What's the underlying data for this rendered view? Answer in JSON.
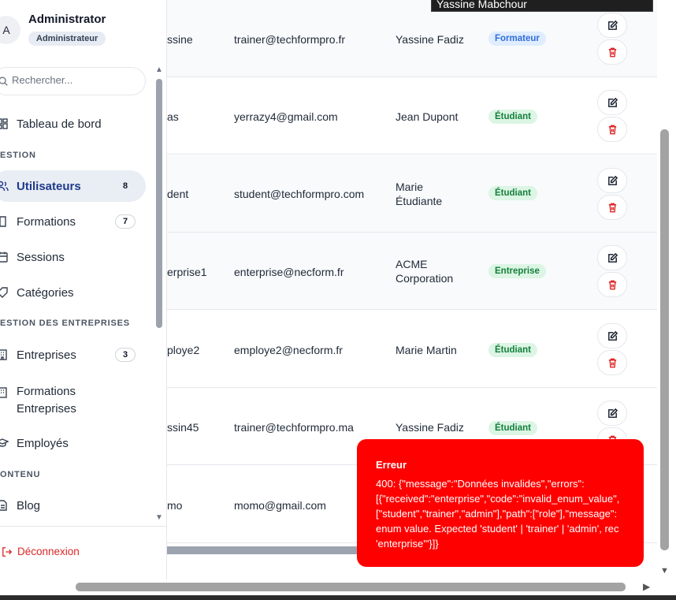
{
  "tooltip": {
    "text": "Yassine Mabchour"
  },
  "sidebar": {
    "avatar_letter": "A",
    "user_name": "Administrator",
    "user_role": "Administrateur",
    "search_placeholder": "Rechercher...",
    "sections": {
      "gestion": "ESTION",
      "entreprises": "ESTION DES ENTREPRISES",
      "contenu": "ONTENU"
    },
    "items": [
      {
        "label": "Tableau de bord",
        "icon": "dashboard-icon"
      },
      {
        "label": "Utilisateurs",
        "count": "8",
        "icon": "users-icon"
      },
      {
        "label": "Formations",
        "count": "7",
        "icon": "book-icon"
      },
      {
        "label": "Sessions",
        "icon": "calendar-icon"
      },
      {
        "label": "Catégories",
        "icon": "tag-icon"
      },
      {
        "label": "Entreprises",
        "count": "3",
        "icon": "building-icon"
      },
      {
        "label": "Formations Entreprises",
        "icon": "building-icon"
      },
      {
        "label": "Employés",
        "icon": "graduation-icon"
      },
      {
        "label": "Blog",
        "icon": "document-icon"
      }
    ],
    "logout_label": "Déconnexion"
  },
  "table": {
    "rows": [
      {
        "username": "ssine",
        "email": "trainer@techformpro.fr",
        "name": "Yassine Fadiz",
        "role": "Formateur"
      },
      {
        "username": "as",
        "email": "yerrazy4@gmail.com",
        "name": "Jean Dupont",
        "role": "Étudiant"
      },
      {
        "username": "dent",
        "email": "student@techformpro.com",
        "name": "Marie Étudiante",
        "role": "Étudiant"
      },
      {
        "username": "erprise1",
        "email": "enterprise@necform.fr",
        "name": "ACME Corporation",
        "role": "Entreprise"
      },
      {
        "username": "ploye2",
        "email": "employe2@necform.fr",
        "name": "Marie Martin",
        "role": "Étudiant"
      },
      {
        "username": "ssin45",
        "email": "trainer@techformpro.ma",
        "name": "Yassine Fadiz",
        "role": "Étudiant"
      },
      {
        "username": "mo",
        "email": "momo@gmail.com",
        "name": "",
        "role": ""
      }
    ]
  },
  "toast": {
    "title": "Erreur",
    "message": "400: {\"message\":\"Données invalides\",\"errors\":\n[{\"received\":\"enterprise\",\"code\":\"invalid_enum_value\",\n[\"student\",\"trainer\",\"admin\"],\"path\":[\"role\"],\"message\":\nenum value. Expected 'student' | 'trainer' | 'admin', rec\n'enterprise'\"}]}"
  },
  "colors": {
    "accent": "#1e3a8a",
    "danger": "#dc2626",
    "toast": "#ff0000"
  }
}
